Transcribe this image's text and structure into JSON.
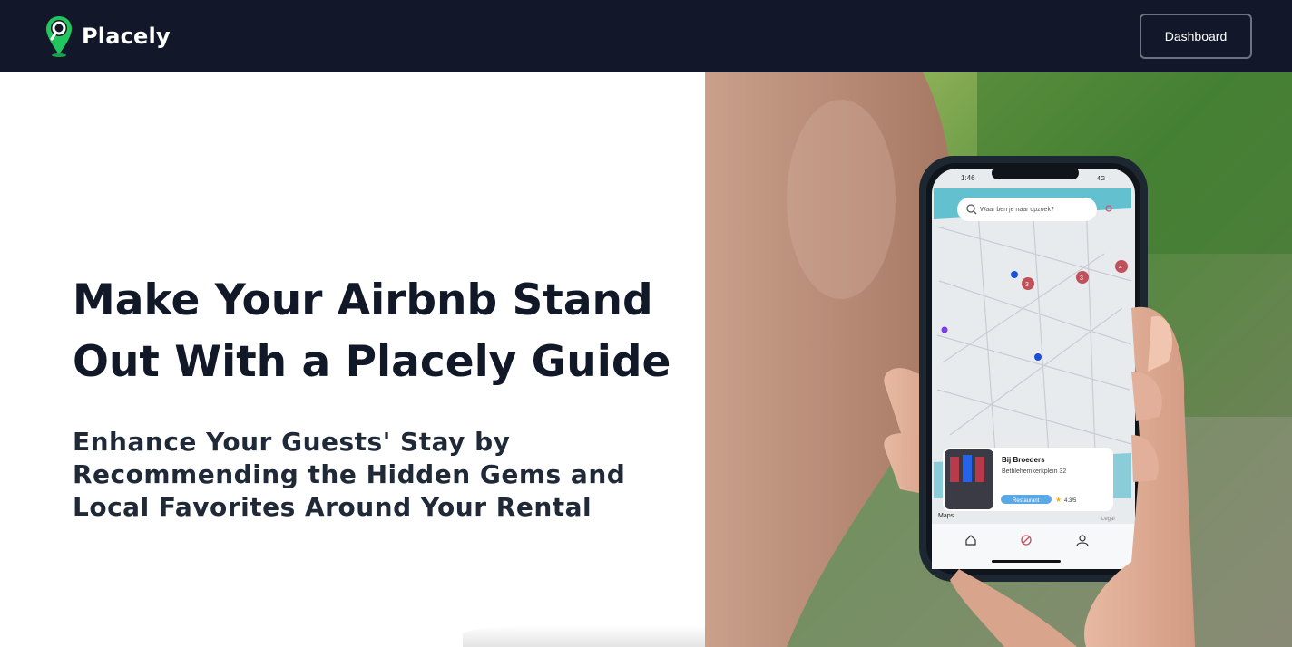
{
  "header": {
    "brand_name": "Placely",
    "dashboard_label": "Dashboard"
  },
  "hero": {
    "title": "Make Your Airbnb Stand Out With a Placely Guide",
    "subtitle": "Enhance Your Guests' Stay by Recommending the Hidden Gems and Local Favorites Around Your Rental"
  },
  "phone": {
    "time": "1:46",
    "network": "4G",
    "search_placeholder": "Waar ben je naar opzoek?",
    "place_name": "Bij Broeders",
    "place_address": "Bethlehemkerkplein 32",
    "place_category": "Restaurant",
    "place_rating": "4.3/5",
    "maps_label": "Maps",
    "legal_label": "Legal",
    "markers": [
      "3",
      "3",
      "4"
    ]
  },
  "colors": {
    "nav_bg": "#121829",
    "brand_green": "#22c55e",
    "title_text": "#111827",
    "marker_red": "#c0505a",
    "marker_blue": "#1d4ed8"
  },
  "icons": [
    "map-pin-logo-icon",
    "search-icon",
    "filter-icon",
    "home-icon",
    "compass-icon",
    "user-icon",
    "star-icon",
    "restaurant-tag-icon"
  ]
}
